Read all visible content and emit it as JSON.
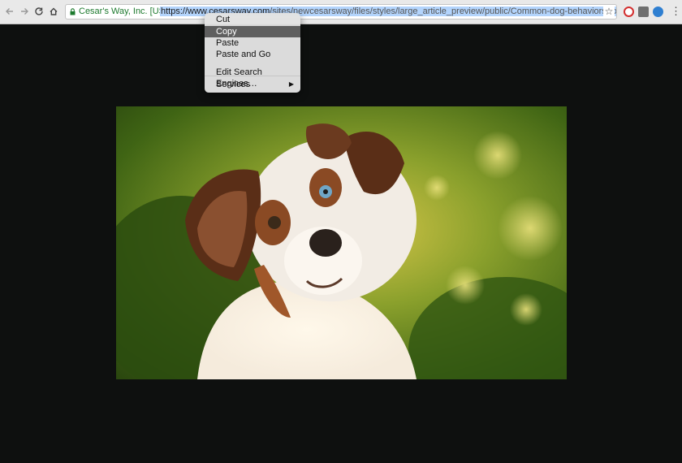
{
  "browser": {
    "security_label": "Cesar's Way, Inc. [US]",
    "url_host": "https://www.cesarsway.com",
    "url_path": "/sites/newcesarsway/files/styles/large_article_preview/public/Common-dog-behaviors-explained.jpg?",
    "icons": [
      "back-icon",
      "forward-icon",
      "reload-icon",
      "home-icon",
      "lock-icon",
      "bookmark-star-icon",
      "opera-extension-icon",
      "chat-extension-icon",
      "puzzle-extension-icon",
      "menu-dots-icon"
    ],
    "colors": {
      "toolbar": "#e9e9e9",
      "selection": "#b3d4fc",
      "secure": "#1d7a2e",
      "page_background": "#0e100f"
    }
  },
  "context_menu": {
    "items": [
      "Cut",
      "Copy",
      "Paste",
      "Paste and Go"
    ],
    "items2": [
      "Edit Search Engines…",
      "Services"
    ],
    "selected": "Copy"
  },
  "image": {
    "description_icon": "dog-photo",
    "colors": {
      "fur_white": "#f2ece4",
      "fur_brown": "#7a4424",
      "background_green": "#5f8a18"
    }
  }
}
